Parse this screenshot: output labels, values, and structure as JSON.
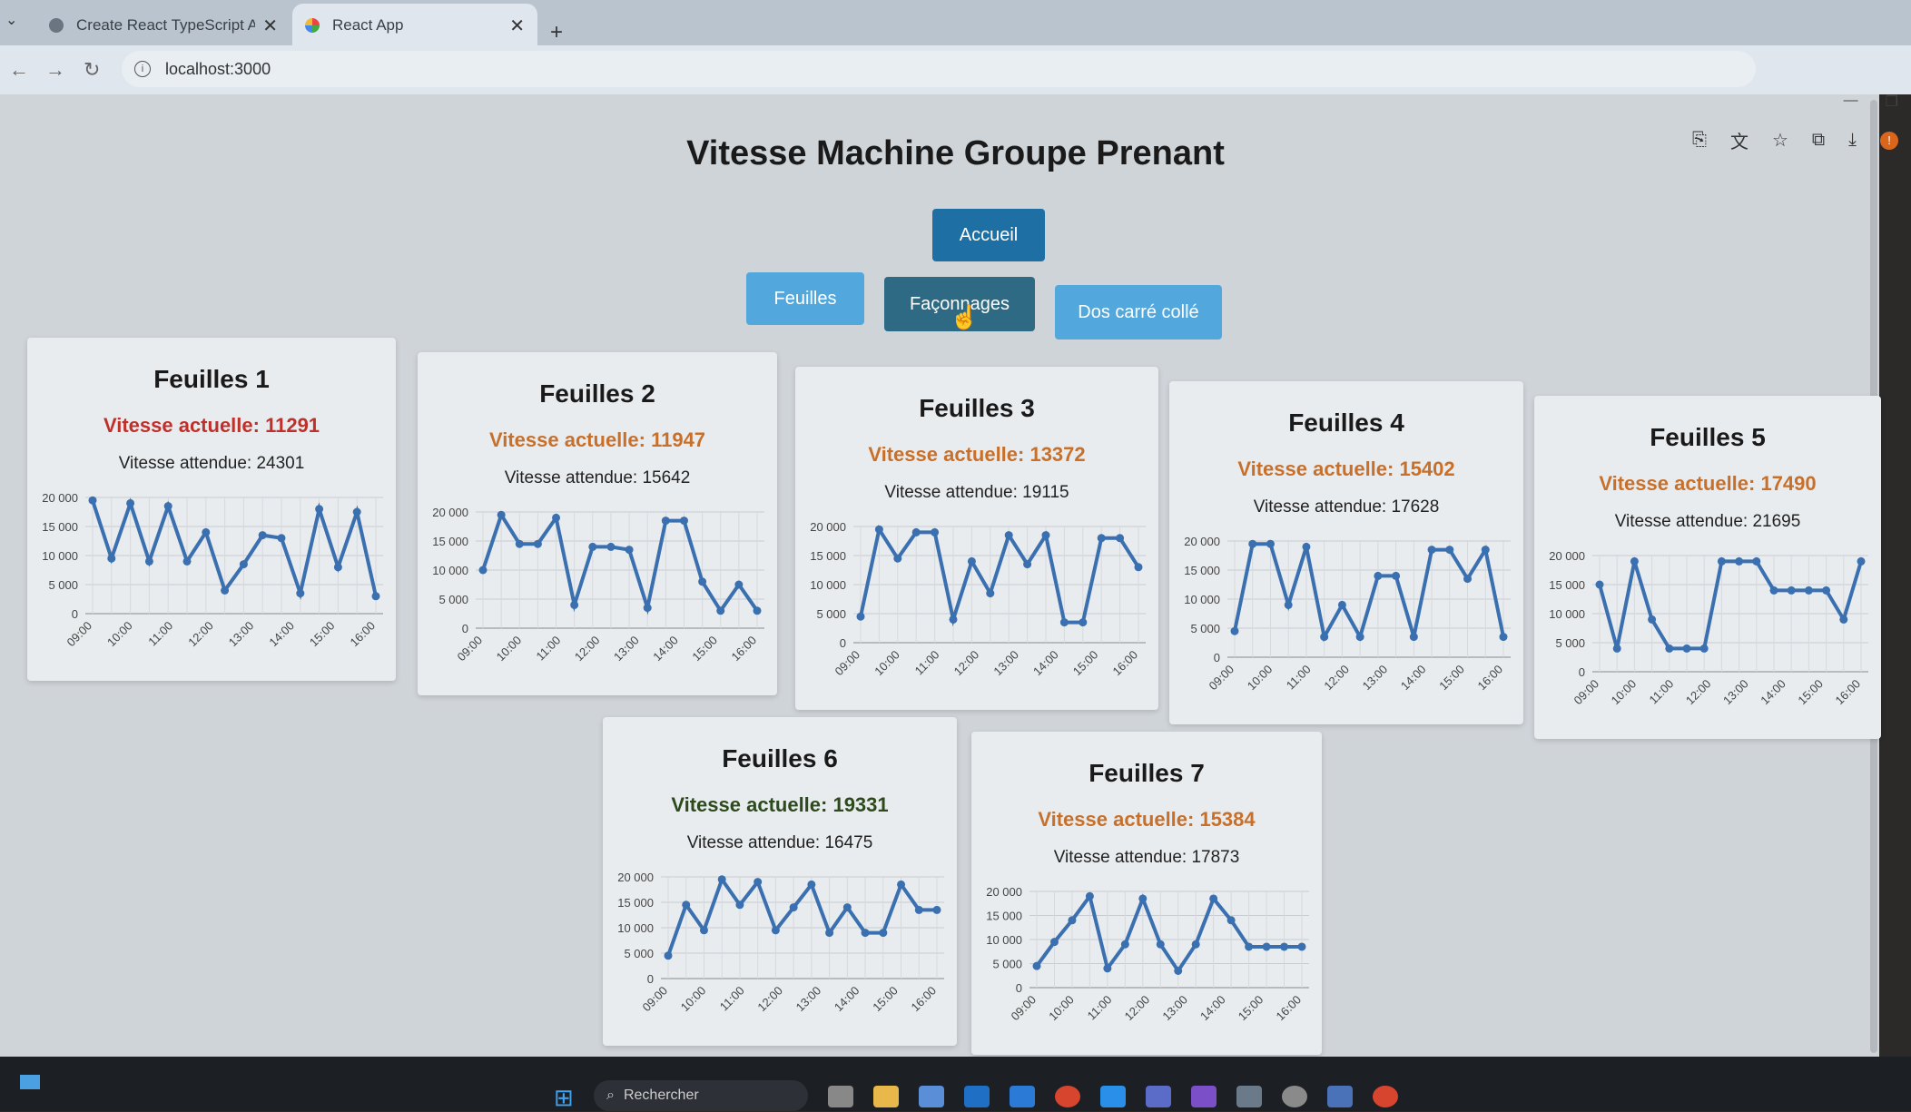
{
  "browser": {
    "tabs": [
      {
        "label": "Create React TypeScript App",
        "active": false
      },
      {
        "label": "React App",
        "active": true
      }
    ],
    "url": "localhost:3000"
  },
  "page": {
    "title": "Vitesse Machine Groupe Prenant",
    "home_button": "Accueil",
    "category_buttons": [
      "Feuilles",
      "Façonnages",
      "Dos carré collé"
    ],
    "current_prefix": "Vitesse actuelle: ",
    "expected_prefix": "Vitesse attendue: "
  },
  "colors": {
    "accent": "#1e6fa3",
    "button_light": "#52a8dd",
    "button_selected": "#2e6a83",
    "line": "#3a6fb0",
    "status_red": "#c0302a",
    "status_orange": "#c8702a",
    "status_green": "#2c4a1c"
  },
  "cards": [
    {
      "title": "Feuilles 1",
      "current": "Vitesse actuelle: 11291",
      "expected": "Vitesse attendue: 24301",
      "status": "red"
    },
    {
      "title": "Feuilles 2",
      "current": "Vitesse actuelle: 11947",
      "expected": "Vitesse attendue: 15642",
      "status": "orange"
    },
    {
      "title": "Feuilles 3",
      "current": "Vitesse actuelle: 13372",
      "expected": "Vitesse attendue: 19115",
      "status": "orange"
    },
    {
      "title": "Feuilles 4",
      "current": "Vitesse actuelle: 15402",
      "expected": "Vitesse attendue: 17628",
      "status": "orange"
    },
    {
      "title": "Feuilles 5",
      "current": "Vitesse actuelle: 17490",
      "expected": "Vitesse attendue: 21695",
      "status": "orange"
    },
    {
      "title": "Feuilles 6",
      "current": "Vitesse actuelle: 19331",
      "expected": "Vitesse attendue: 16475",
      "status": "green"
    },
    {
      "title": "Feuilles 7",
      "current": "Vitesse actuelle: 15384",
      "expected": "Vitesse attendue: 17873",
      "status": "orange"
    }
  ],
  "chart_data": [
    {
      "type": "line",
      "x": [
        "09:00",
        "09:30",
        "10:00",
        "10:30",
        "11:00",
        "11:30",
        "12:00",
        "12:30",
        "13:00",
        "13:30",
        "14:00",
        "14:30",
        "15:00",
        "15:30",
        "16:00"
      ],
      "x_tick_labels": [
        "09:00",
        "10:00",
        "11:00",
        "12:00",
        "13:00",
        "14:00",
        "15:00",
        "16:00"
      ],
      "y_ticks": [
        "0",
        "5 000",
        "10 000",
        "15 000",
        "20 000"
      ],
      "ylim": [
        0,
        20000
      ],
      "series": [
        {
          "values": [
            19500,
            9500,
            19000,
            9000,
            18500,
            9000,
            14000,
            4000,
            8500,
            13500,
            13000,
            3500,
            18000,
            8000,
            17500,
            3000
          ]
        }
      ]
    },
    {
      "type": "line",
      "x": [
        "09:00",
        "09:30",
        "10:00",
        "10:30",
        "11:00",
        "11:30",
        "12:00",
        "12:30",
        "13:00",
        "13:30",
        "14:00",
        "14:30",
        "15:00",
        "15:30",
        "16:00"
      ],
      "x_tick_labels": [
        "09:00",
        "10:00",
        "11:00",
        "12:00",
        "13:00",
        "14:00",
        "15:00",
        "16:00"
      ],
      "y_ticks": [
        "0",
        "5 000",
        "10 000",
        "15 000",
        "20 000"
      ],
      "ylim": [
        0,
        20000
      ],
      "series": [
        {
          "values": [
            10000,
            19500,
            14500,
            14500,
            19000,
            4000,
            14000,
            14000,
            13500,
            3500,
            18500,
            18500,
            8000,
            3000,
            7500,
            3000
          ]
        }
      ]
    },
    {
      "type": "line",
      "x": [
        "09:00",
        "09:30",
        "10:00",
        "10:30",
        "11:00",
        "11:30",
        "12:00",
        "12:30",
        "13:00",
        "13:30",
        "14:00",
        "14:30",
        "15:00",
        "15:30",
        "16:00"
      ],
      "x_tick_labels": [
        "09:00",
        "10:00",
        "11:00",
        "12:00",
        "13:00",
        "14:00",
        "15:00",
        "16:00"
      ],
      "y_ticks": [
        "0",
        "5 000",
        "10 000",
        "15 000",
        "20 000"
      ],
      "ylim": [
        0,
        20000
      ],
      "series": [
        {
          "values": [
            4500,
            19500,
            14500,
            19000,
            19000,
            4000,
            14000,
            8500,
            18500,
            13500,
            18500,
            3500,
            3500,
            18000,
            18000,
            13000
          ]
        }
      ]
    },
    {
      "type": "line",
      "x": [
        "09:00",
        "09:30",
        "10:00",
        "10:30",
        "11:00",
        "11:30",
        "12:00",
        "12:30",
        "13:00",
        "13:30",
        "14:00",
        "14:30",
        "15:00",
        "15:30",
        "16:00"
      ],
      "x_tick_labels": [
        "09:00",
        "10:00",
        "11:00",
        "12:00",
        "13:00",
        "14:00",
        "15:00",
        "16:00"
      ],
      "y_ticks": [
        "0",
        "5 000",
        "10 000",
        "15 000",
        "20 000"
      ],
      "ylim": [
        0,
        20000
      ],
      "series": [
        {
          "values": [
            4500,
            19500,
            19500,
            9000,
            19000,
            3500,
            9000,
            3500,
            14000,
            14000,
            3500,
            18500,
            18500,
            13500,
            18500,
            3500
          ]
        }
      ]
    },
    {
      "type": "line",
      "x": [
        "09:00",
        "09:30",
        "10:00",
        "10:30",
        "11:00",
        "11:30",
        "12:00",
        "12:30",
        "13:00",
        "13:30",
        "14:00",
        "14:30",
        "15:00",
        "15:30",
        "16:00"
      ],
      "x_tick_labels": [
        "09:00",
        "10:00",
        "11:00",
        "12:00",
        "13:00",
        "14:00",
        "15:00",
        "16:00"
      ],
      "y_ticks": [
        "0",
        "5 000",
        "10 000",
        "15 000",
        "20 000"
      ],
      "ylim": [
        0,
        20000
      ],
      "series": [
        {
          "values": [
            15000,
            4000,
            19000,
            9000,
            4000,
            4000,
            4000,
            19000,
            19000,
            19000,
            14000,
            14000,
            14000,
            14000,
            9000,
            19000
          ]
        }
      ]
    },
    {
      "type": "line",
      "x": [
        "09:00",
        "09:30",
        "10:00",
        "10:30",
        "11:00",
        "11:30",
        "12:00",
        "12:30",
        "13:00",
        "13:30",
        "14:00",
        "14:30",
        "15:00",
        "15:30",
        "16:00"
      ],
      "x_tick_labels": [
        "09:00",
        "10:00",
        "11:00",
        "12:00",
        "13:00",
        "14:00",
        "15:00",
        "16:00"
      ],
      "y_ticks": [
        "0",
        "5 000",
        "10 000",
        "15 000",
        "20 000"
      ],
      "ylim": [
        0,
        20000
      ],
      "series": [
        {
          "values": [
            4500,
            14500,
            9500,
            19500,
            14500,
            19000,
            9500,
            14000,
            18500,
            9000,
            14000,
            9000,
            9000,
            18500,
            13500,
            13500
          ]
        }
      ]
    },
    {
      "type": "line",
      "x": [
        "09:00",
        "09:30",
        "10:00",
        "10:30",
        "11:00",
        "11:30",
        "12:00",
        "12:30",
        "13:00",
        "13:30",
        "14:00",
        "14:30",
        "15:00",
        "15:30",
        "16:00"
      ],
      "x_tick_labels": [
        "09:00",
        "10:00",
        "11:00",
        "12:00",
        "13:00",
        "14:00",
        "15:00",
        "16:00"
      ],
      "y_ticks": [
        "0",
        "5 000",
        "10 000",
        "15 000",
        "20 000"
      ],
      "ylim": [
        0,
        20000
      ],
      "series": [
        {
          "values": [
            4500,
            9500,
            14000,
            19000,
            4000,
            9000,
            18500,
            9000,
            3500,
            9000,
            18500,
            14000,
            8500,
            8500,
            8500,
            8500
          ]
        }
      ]
    }
  ],
  "taskbar": {
    "search_placeholder": "Rechercher"
  }
}
